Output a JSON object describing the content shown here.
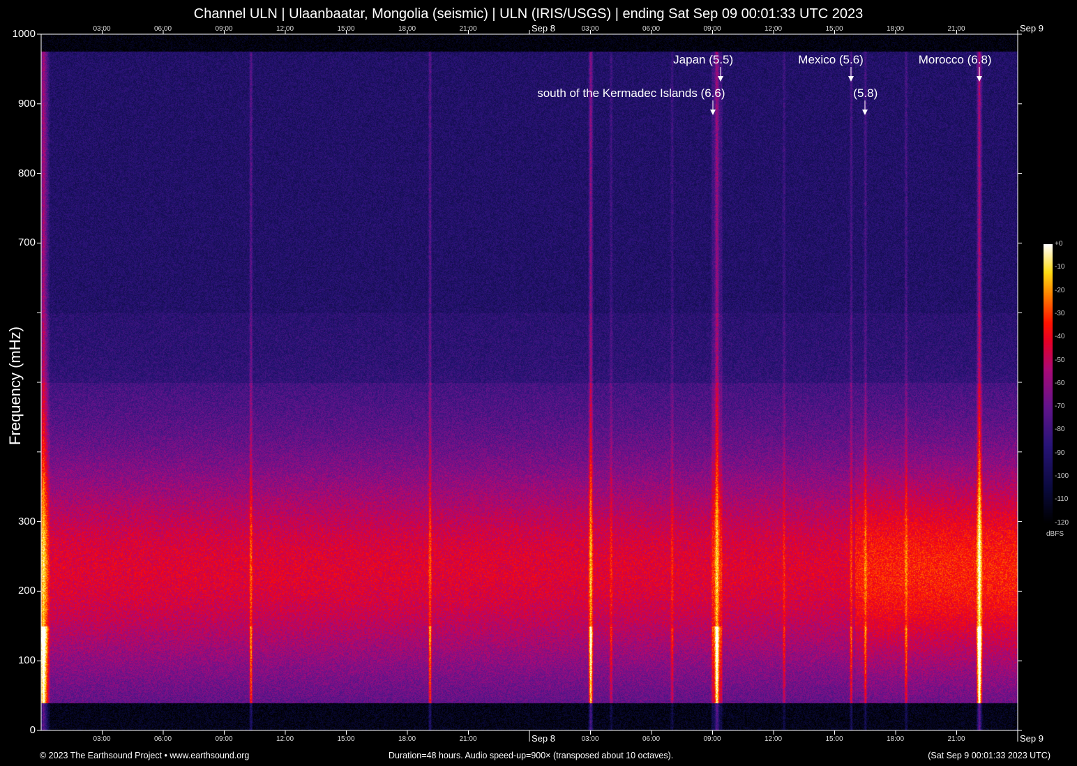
{
  "title": "Channel ULN | Ulaanbaatar, Mongolia (seismic) | ULN (IRIS/USGS) | ending Sat Sep 09 00:01:33 UTC 2023",
  "footer": {
    "left": "© 2023 The Earthsound Project • www.earthsound.org",
    "middle": "Duration=48 hours. Audio speed-up=900× (transposed about 10 octaves).",
    "right": "(Sat Sep  9 00:01:33 2023 UTC)"
  },
  "chart_data": {
    "type": "heatmap",
    "title": "Channel ULN | Ulaanbaatar, Mongolia (seismic) | ULN (IRIS/USGS) | ending Sat Sep 09 00:01:33 UTC 2023",
    "ylabel": "Frequency (mHz)",
    "ylim": [
      0,
      1000
    ],
    "yticks": [
      {
        "v": 0,
        "l": "0"
      },
      {
        "v": 100,
        "l": "100"
      },
      {
        "v": 200,
        "l": "200"
      },
      {
        "v": 300,
        "l": "300"
      },
      {
        "v": 400,
        "l": ""
      },
      {
        "v": 500,
        "l": ""
      },
      {
        "v": 600,
        "l": ""
      },
      {
        "v": 700,
        "l": "700"
      },
      {
        "v": 800,
        "l": "800"
      },
      {
        "v": 900,
        "l": "900"
      },
      {
        "v": 1000,
        "l": "1000"
      }
    ],
    "xlim_hours": [
      0,
      48
    ],
    "xticks": [
      {
        "h": 3,
        "l": "03:00"
      },
      {
        "h": 6,
        "l": "06:00"
      },
      {
        "h": 9,
        "l": "09:00"
      },
      {
        "h": 12,
        "l": "12:00"
      },
      {
        "h": 15,
        "l": "15:00"
      },
      {
        "h": 18,
        "l": "18:00"
      },
      {
        "h": 21,
        "l": "21:00"
      },
      {
        "h": 24,
        "l": "Sep  8"
      },
      {
        "h": 27,
        "l": "03:00"
      },
      {
        "h": 30,
        "l": "06:00"
      },
      {
        "h": 33,
        "l": "09:00"
      },
      {
        "h": 36,
        "l": "12:00"
      },
      {
        "h": 39,
        "l": "15:00"
      },
      {
        "h": 42,
        "l": "18:00"
      },
      {
        "h": 45,
        "l": "21:00"
      },
      {
        "h": 48,
        "l": "Sep  9"
      }
    ],
    "colorbar": {
      "label": "dBFS",
      "range": [
        -120,
        0
      ],
      "ticks": [
        "+0",
        "-10",
        "-20",
        "-30",
        "-40",
        "-50",
        "-60",
        "-70",
        "-80",
        "-90",
        "-100",
        "-110",
        "-120"
      ]
    },
    "events": [
      {
        "label": "Japan (5.5)",
        "hour": 33.4,
        "row": 1
      },
      {
        "label": "south of the Kermadec Islands (6.6)",
        "hour": 33.0,
        "row": 2
      },
      {
        "label": "Mexico (5.6)",
        "hour": 39.8,
        "row": 1
      },
      {
        "label": "(5.8)",
        "hour": 40.5,
        "row": 2
      },
      {
        "label": "Morocco (6.8)",
        "hour": 46.1,
        "row": 1
      }
    ]
  }
}
